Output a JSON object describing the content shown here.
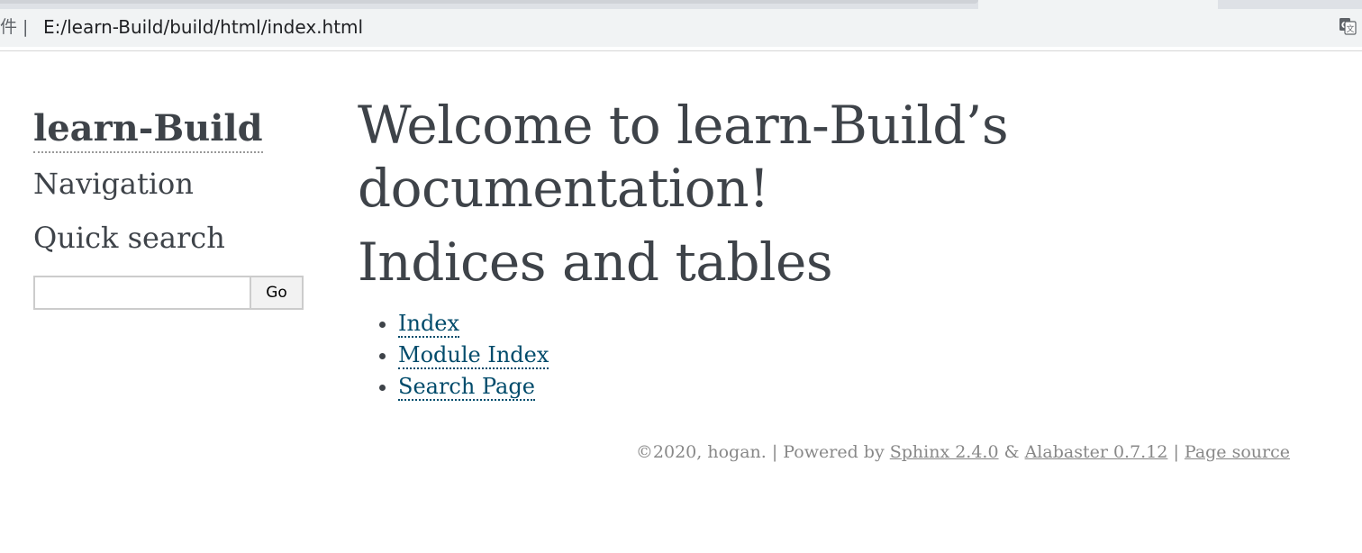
{
  "browser": {
    "file_label": "件 |",
    "url": "E:/learn-Build/build/html/index.html",
    "translate_icon": "translate-icon"
  },
  "sidebar": {
    "logo": "learn-Build",
    "navigation_heading": "Navigation",
    "search_heading": "Quick search",
    "search_value": "",
    "search_button": "Go"
  },
  "main": {
    "title": "Welcome to learn-Build’s documentation!",
    "section_title": "Indices and tables",
    "links": [
      {
        "label": "Index"
      },
      {
        "label": "Module Index"
      },
      {
        "label": "Search Page"
      }
    ]
  },
  "footer": {
    "copyright": "©2020, hogan.",
    "sep1": "|",
    "powered_by": "Powered by",
    "sphinx": "Sphinx 2.4.0",
    "amp": "&",
    "alabaster": "Alabaster 0.7.12",
    "sep2": "|",
    "page_source": "Page source"
  },
  "colors": {
    "text": "#3e4349",
    "link": "#004b6b",
    "footer": "#888888",
    "chrome": "#f1f3f4"
  }
}
